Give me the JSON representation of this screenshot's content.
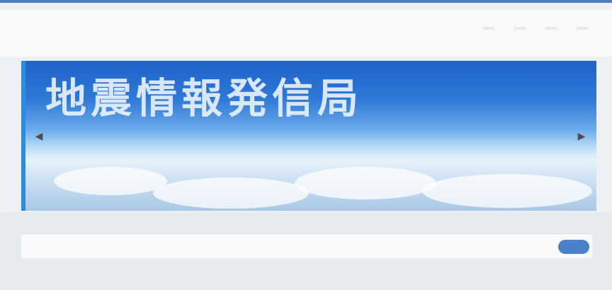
{
  "top": {
    "tagline": ""
  },
  "header": {
    "logo_main": "",
    "logo_sub": "",
    "nav": [
      "",
      "",
      "",
      "",
      ""
    ]
  },
  "banner": {
    "title": "地震情報発信局",
    "subtitle": "",
    "subtitle2": ""
  },
  "news": {
    "date": "",
    "more_label": "",
    "link_text": ""
  },
  "colors": {
    "accent": "#4a82c9",
    "brand": "#2b4e8c"
  }
}
